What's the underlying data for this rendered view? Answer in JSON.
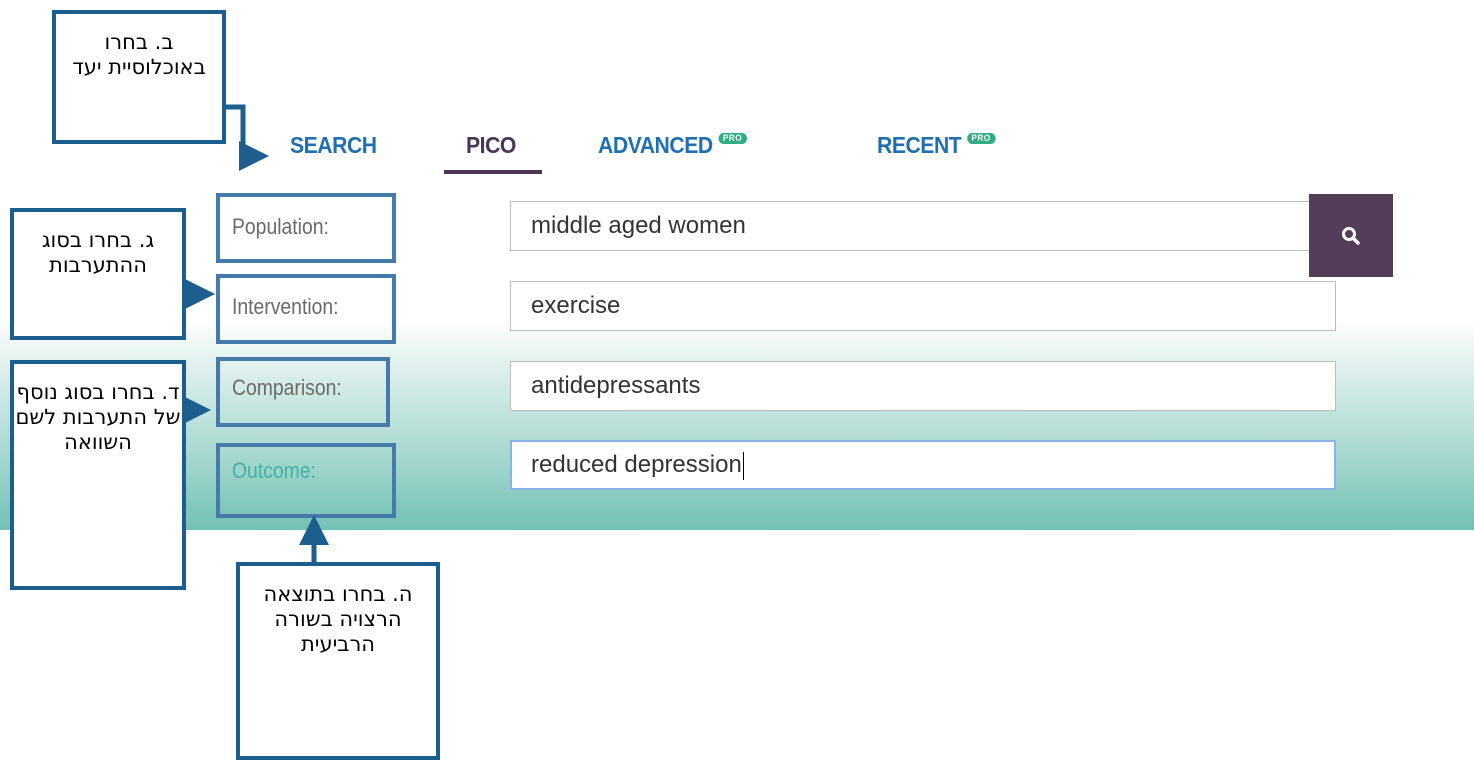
{
  "tabs": [
    {
      "label": "SEARCH",
      "active": false,
      "pro": false
    },
    {
      "label": "PICO",
      "active": true,
      "pro": false
    },
    {
      "label": "ADVANCED",
      "active": false,
      "pro": true
    },
    {
      "label": "RECENT",
      "active": false,
      "pro": true
    }
  ],
  "pro_badge": "PRO",
  "pico": {
    "population": {
      "label": "Population:",
      "value": "middle aged women"
    },
    "intervention": {
      "label": "Intervention:",
      "value": "exercise"
    },
    "comparison": {
      "label": "Comparison:",
      "value": "antidepressants"
    },
    "outcome": {
      "label": "Outcome:",
      "value": "reduced depression"
    }
  },
  "search_button_icon": "search-icon",
  "annotations": {
    "population": "ב. בחרו באוכלוסיית יעד",
    "intervention": "ג. בחרו בסוג ההתערבות",
    "comparison": "ד. בחרו בסוג נוסף של התערבות לשם השוואה",
    "outcome": "ה. בחרו בתוצאה הרצויה בשורה הרביעית"
  },
  "colors": {
    "tab_blue": "#1f6fb2",
    "tab_active": "#4b3454",
    "search_button": "#533d59",
    "pro_badge": "#2fae84",
    "annotation_border": "#1c5f8e",
    "gradient_bottom": "#72c1b5"
  }
}
